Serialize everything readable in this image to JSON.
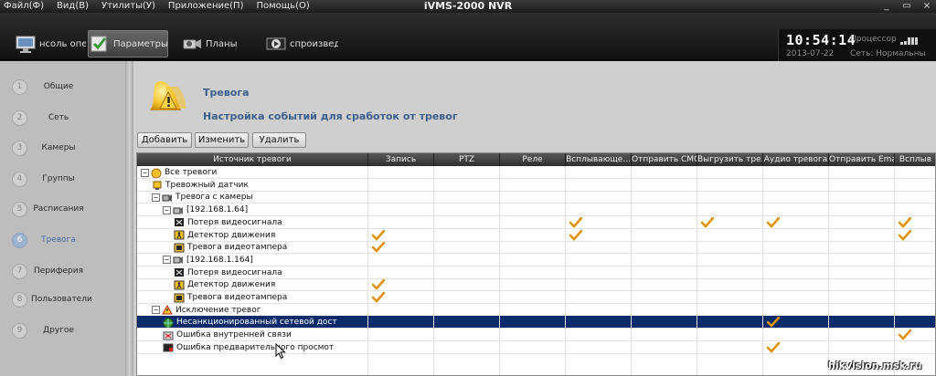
{
  "window": {
    "title": "iVMS-2000 NVR",
    "menu": [
      "Файл(Ф)",
      "Вид(В)",
      "Утилиты(У)",
      "Приложение(П)",
      "Помощь(О)"
    ],
    "controls": [
      "_",
      "▭",
      "×"
    ]
  },
  "toolbar": {
    "tabs": [
      {
        "label": "нсоль операто",
        "icon": "monitor-icon"
      },
      {
        "label": "Параметры",
        "icon": "settings-check-icon",
        "active": true
      },
      {
        "label": "Планы",
        "icon": "camera-plans-icon"
      },
      {
        "label": "спроизведени",
        "icon": "playback-icon"
      }
    ],
    "status": {
      "time": "10:54:14",
      "date": "2013-07-22",
      "cpu_label": "Процессор",
      "net_label": "Сеть: Нормальны"
    }
  },
  "nav": {
    "items": [
      {
        "num": "1",
        "label": "Общие"
      },
      {
        "num": "2",
        "label": "Сеть"
      },
      {
        "num": "3",
        "label": "Камеры"
      },
      {
        "num": "4",
        "label": "Группы"
      },
      {
        "num": "5",
        "label": "Расписания"
      },
      {
        "num": "6",
        "label": "Тревога",
        "active": true
      },
      {
        "num": "7",
        "label": "Периферия"
      },
      {
        "num": "8",
        "label": "Пользователи"
      },
      {
        "num": "9",
        "label": "Другое"
      }
    ]
  },
  "main": {
    "title": "Тревога",
    "subtitle": "Настройка событий для сработок от тревог",
    "buttons": {
      "add": "Добавить",
      "edit": "Изменить",
      "delete": "Удалить"
    },
    "columns": [
      "Источник тревоги",
      "Запись",
      "PTZ",
      "Реле",
      "Всплывающе...",
      "Отправить СМС",
      "Выгрузить тре...",
      "Аудио тревога",
      "Отправить Email",
      "Всплыв"
    ],
    "rows": [
      {
        "label": "Все тревоги",
        "level": 0,
        "expander": "−",
        "icon": "bell-icon",
        "checks": []
      },
      {
        "label": "Тревожный датчик",
        "level": 1,
        "icon": "sensor-icon",
        "checks": []
      },
      {
        "label": "Тревога с камеры",
        "level": 1,
        "expander": "−",
        "icon": "camera-alarm-icon",
        "checks": []
      },
      {
        "label": "[192.168.1.64]",
        "level": 2,
        "expander": "−",
        "icon": "camera-icon",
        "checks": []
      },
      {
        "label": "Потеря видеосигнала",
        "level": 3,
        "icon": "video-loss-icon",
        "checks": [
          4,
          6,
          7,
          9
        ]
      },
      {
        "label": "Детектор движения",
        "level": 3,
        "icon": "motion-icon",
        "checks": [
          1,
          4,
          9
        ]
      },
      {
        "label": "Тревога видеотампера",
        "level": 3,
        "icon": "tamper-icon",
        "checks": [
          1
        ]
      },
      {
        "label": "[192.168.1.164]",
        "level": 2,
        "expander": "−",
        "icon": "camera-icon",
        "checks": []
      },
      {
        "label": "Потеря видеосигнала",
        "level": 3,
        "icon": "video-loss-icon",
        "checks": []
      },
      {
        "label": "Детектор движения",
        "level": 3,
        "icon": "motion-icon",
        "checks": [
          1
        ]
      },
      {
        "label": "Тревога видеотампера",
        "level": 3,
        "icon": "tamper-icon",
        "checks": [
          1
        ]
      },
      {
        "label": "Исключение тревог",
        "level": 1,
        "expander": "−",
        "icon": "warning-icon",
        "checks": []
      },
      {
        "label": "Несанкционированный сетевой дост",
        "level": 2,
        "icon": "globe-icon",
        "checks": [
          7
        ],
        "selected": true
      },
      {
        "label": "Ошибка внутренней связи",
        "level": 2,
        "icon": "link-error-icon",
        "checks": [
          9
        ]
      },
      {
        "label": "Ошибка предварительного просмот",
        "level": 2,
        "icon": "preview-error-icon",
        "checks": [
          7
        ]
      }
    ]
  },
  "watermark": "hikvision.msk.ru"
}
